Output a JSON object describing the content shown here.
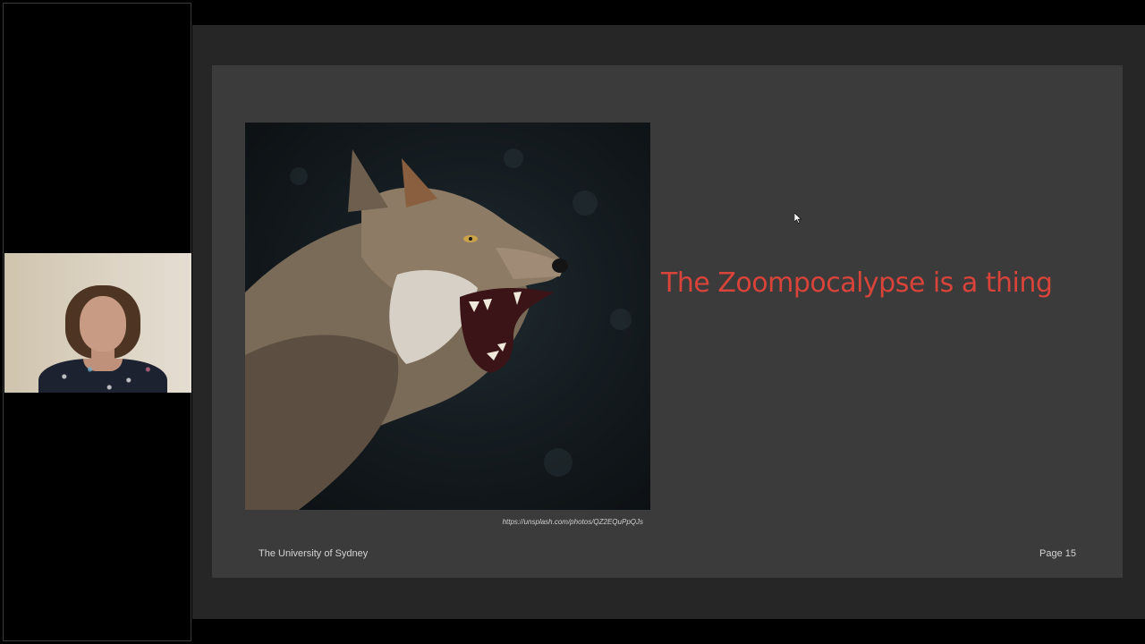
{
  "participant": {
    "name": ""
  },
  "slide": {
    "title": "The Zoompocalypse is a thing",
    "photo_credit": "https://unsplash.com/photos/QZ2EQuPpQJs",
    "footer_left": "The University of Sydney",
    "page_number": "Page 15",
    "title_color": "#d8433a"
  }
}
